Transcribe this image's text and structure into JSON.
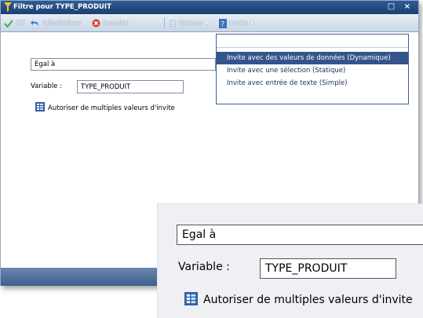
{
  "window": {
    "title": "Filtre pour TYPE_PRODUIT",
    "buttons": "□ ×"
  },
  "toolbar": {
    "ok": "OK",
    "reset": "Réinitialiser",
    "cancel": "Annuler",
    "values": "Valeurs",
    "prompt": "Invite"
  },
  "form": {
    "operator": "Egal à",
    "variable_label": "Variable :",
    "variable_value": "TYPE_PRODUIT",
    "multi_values": "Autoriser de multiples valeurs d'invite"
  },
  "menu": {
    "items": [
      "Invite avec des valeurs de données (Dynamique)",
      "Invite avec une sélection (Statique)",
      "Invite avec entrée de texte (Simple)"
    ],
    "highlighted_index": 0
  },
  "zoom": {
    "operator": "Egal à",
    "variable_label": "Variable :",
    "variable_value": "TYPE_PRODUIT",
    "multi_values": "Autoriser de multiples valeurs d'invite"
  },
  "colors": {
    "title_bar": "#1c3f71",
    "menu_highlight": "#33558b",
    "ok_check": "#3cb043",
    "cancel_red": "#d23b2a"
  }
}
